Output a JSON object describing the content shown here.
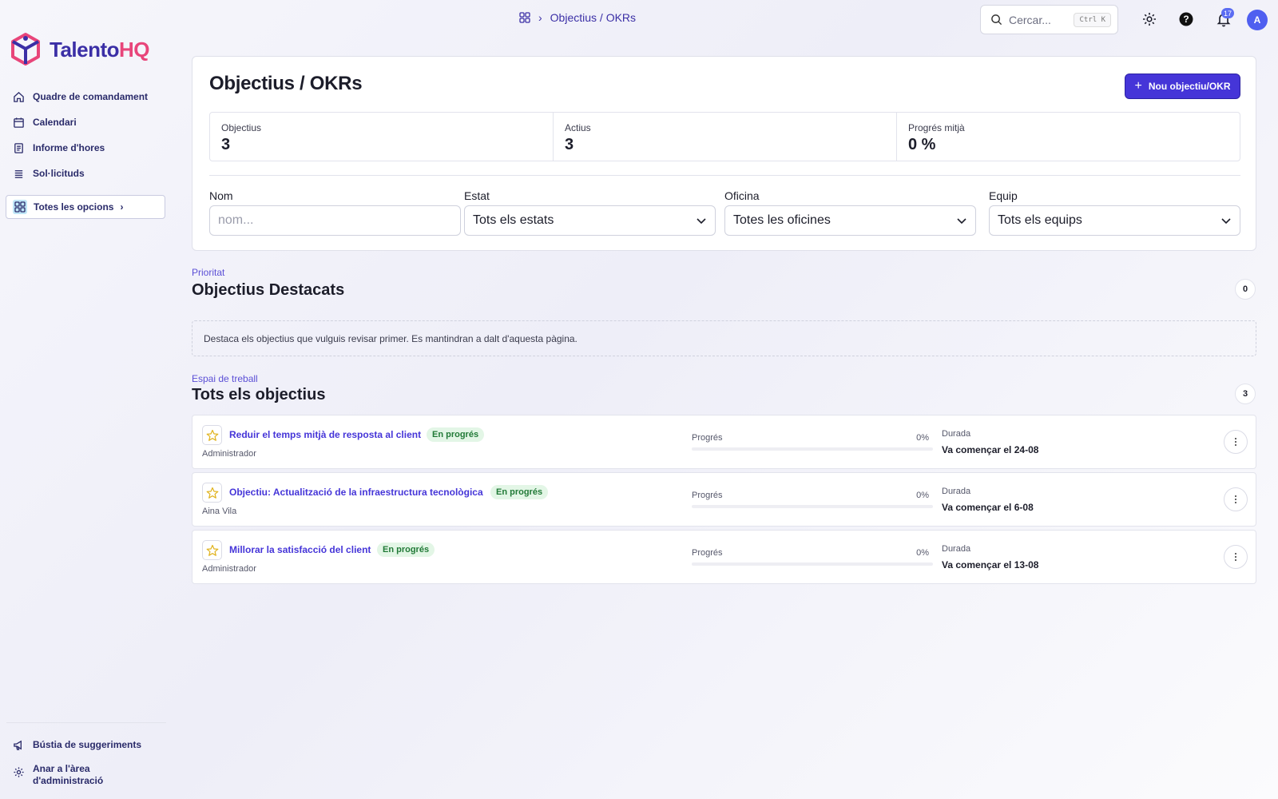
{
  "brand": {
    "name_part1": "Talento",
    "name_part2": "HQ",
    "color_primary": "#3b2fa6",
    "color_accent": "#e8457a"
  },
  "sidebar": {
    "items": [
      {
        "label": "Quadre de comandament",
        "icon": "home-icon"
      },
      {
        "label": "Calendari",
        "icon": "calendar-icon"
      },
      {
        "label": "Informe d'hores",
        "icon": "report-icon"
      },
      {
        "label": "Sol·licituds",
        "icon": "list-icon"
      }
    ],
    "all_options": "Totes les opcions",
    "bottom": [
      {
        "label": "Bústia de suggeriments",
        "icon": "megaphone-icon"
      },
      {
        "label": "Anar a l'àrea d'administració",
        "icon": "gear-icon"
      }
    ]
  },
  "topbar": {
    "breadcrumb": "Objectius / OKRs",
    "search_placeholder": "Cercar...",
    "search_shortcut": "Ctrl K",
    "notification_count": "17",
    "avatar_initial": "A"
  },
  "header": {
    "title": "Objectius / OKRs",
    "new_button": "Nou objectiu/OKR"
  },
  "stats": [
    {
      "label": "Objectius",
      "value": "3"
    },
    {
      "label": "Actius",
      "value": "3"
    },
    {
      "label": "Progrés mitjà",
      "value": "0 %"
    }
  ],
  "filters": {
    "name": {
      "label": "Nom",
      "placeholder": "nom..."
    },
    "status": {
      "label": "Estat",
      "value": "Tots els estats"
    },
    "office": {
      "label": "Oficina",
      "value": "Totes les oficines"
    },
    "team": {
      "label": "Equip",
      "value": "Tots els equips"
    }
  },
  "featured": {
    "eyebrow": "Prioritat",
    "title": "Objectius Destacats",
    "count": "0",
    "empty_note": "Destaca els objectius que vulguis revisar primer. Es mantindran a dalt d'aquesta pàgina."
  },
  "all": {
    "eyebrow": "Espai de treball",
    "title": "Tots els objectius",
    "count": "3"
  },
  "objectives": [
    {
      "title": "Reduir el temps mitjà de resposta al client",
      "status": "En progrés",
      "owner": "Administrador",
      "progress_label": "Progrés",
      "progress_text": "0%",
      "progress": 0,
      "duration_label": "Durada",
      "duration": "Va començar el 24-08"
    },
    {
      "title": "Objectiu: Actualització de la infraestructura tecnològica",
      "status": "En progrés",
      "owner": "Aina Vila",
      "progress_label": "Progrés",
      "progress_text": "0%",
      "progress": 0,
      "duration_label": "Durada",
      "duration": "Va començar el 6-08"
    },
    {
      "title": "Millorar la satisfacció del client",
      "status": "En progrés",
      "owner": "Administrador",
      "progress_label": "Progrés",
      "progress_text": "0%",
      "progress": 0,
      "duration_label": "Durada",
      "duration": "Va començar el 13-08"
    }
  ]
}
